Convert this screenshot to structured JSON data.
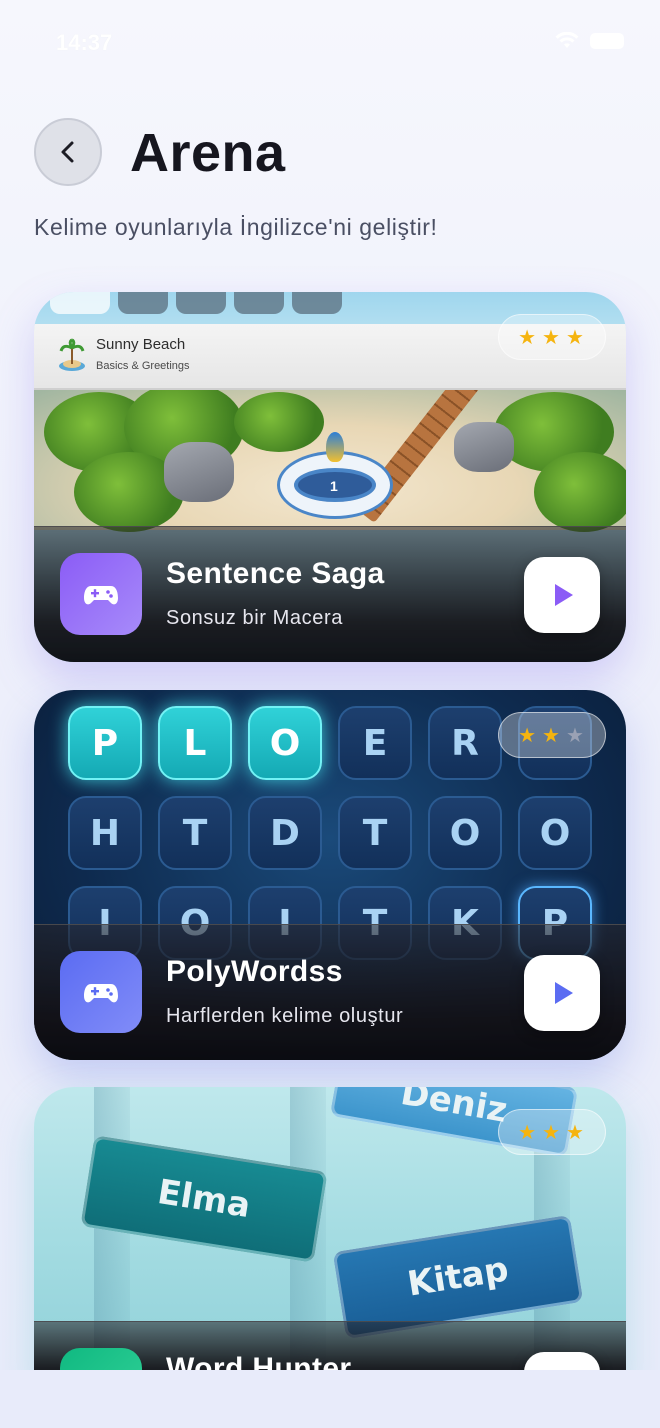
{
  "status_bar": {
    "time": "14:37"
  },
  "header": {
    "title": "Arena",
    "subtitle": "Kelime oyunlarıyla İngilizce'ni geliştir!"
  },
  "games": [
    {
      "title": "Sentence Saga",
      "subtitle": "Sonsuz bir Macera",
      "stars": 3,
      "stars_max": 3,
      "icon": "gamepad-icon",
      "accent": "#8b5cf6",
      "art": {
        "level_title": "Sunny Beach",
        "level_subtitle": "Basics & Greetings",
        "level_number": "1"
      }
    },
    {
      "title": "PolyWordss",
      "subtitle": "Harflerden kelime oluştur",
      "stars": 2,
      "stars_max": 3,
      "icon": "gamepad-icon",
      "accent": "#5b6cf2",
      "art": {
        "tiles": [
          "P",
          "L",
          "O",
          "E",
          "R",
          "",
          "H",
          "T",
          "D",
          "T",
          "O",
          "O",
          "I",
          "O",
          "I",
          "T",
          "K",
          "P"
        ]
      }
    },
    {
      "title": "Word Hunter",
      "stars": 3,
      "stars_max": 3,
      "icon": "gamepad-icon",
      "accent": "#10b981",
      "art": {
        "words": [
          "Deniz",
          "Elma",
          "Kitap"
        ]
      }
    }
  ]
}
